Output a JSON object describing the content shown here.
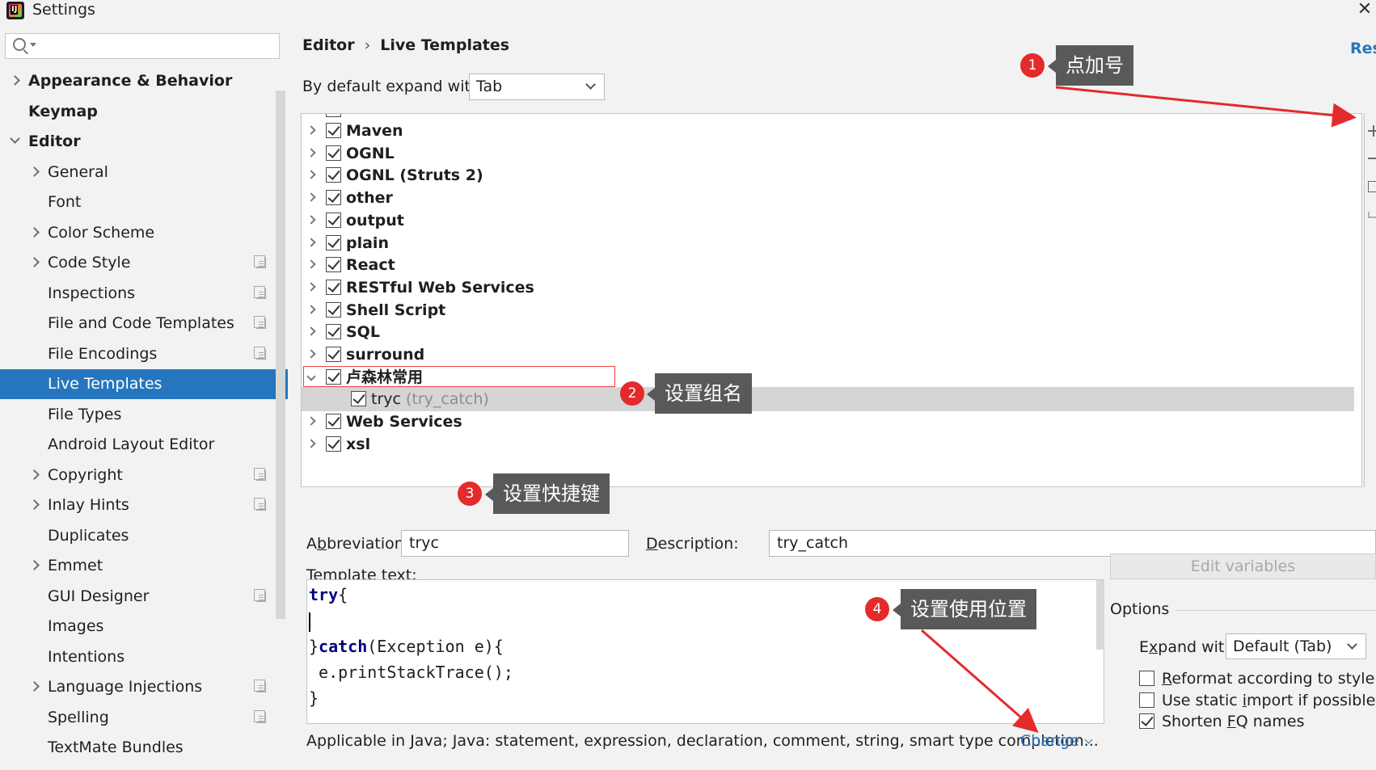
{
  "window": {
    "title": "Settings"
  },
  "sidebar": {
    "search": {
      "value": "",
      "placeholder": ""
    },
    "items": [
      {
        "label": "Appearance & Behavior",
        "level": "top",
        "arrow": "right"
      },
      {
        "label": "Keymap",
        "level": "top",
        "arrow": ""
      },
      {
        "label": "Editor",
        "level": "top",
        "arrow": "down"
      },
      {
        "label": "General",
        "level": "sub",
        "arrow": "right"
      },
      {
        "label": "Font",
        "level": "sub",
        "arrow": ""
      },
      {
        "label": "Color Scheme",
        "level": "sub",
        "arrow": "right"
      },
      {
        "label": "Code Style",
        "level": "sub",
        "arrow": "right",
        "project": true
      },
      {
        "label": "Inspections",
        "level": "sub",
        "arrow": "",
        "project": true
      },
      {
        "label": "File and Code Templates",
        "level": "sub",
        "arrow": "",
        "project": true
      },
      {
        "label": "File Encodings",
        "level": "sub",
        "arrow": "",
        "project": true
      },
      {
        "label": "Live Templates",
        "level": "sub",
        "arrow": "",
        "selected": true
      },
      {
        "label": "File Types",
        "level": "sub",
        "arrow": ""
      },
      {
        "label": "Android Layout Editor",
        "level": "sub",
        "arrow": ""
      },
      {
        "label": "Copyright",
        "level": "sub",
        "arrow": "right",
        "project": true
      },
      {
        "label": "Inlay Hints",
        "level": "sub",
        "arrow": "right",
        "project": true
      },
      {
        "label": "Duplicates",
        "level": "sub",
        "arrow": ""
      },
      {
        "label": "Emmet",
        "level": "sub",
        "arrow": "right"
      },
      {
        "label": "GUI Designer",
        "level": "sub",
        "arrow": "",
        "project": true
      },
      {
        "label": "Images",
        "level": "sub",
        "arrow": ""
      },
      {
        "label": "Intentions",
        "level": "sub",
        "arrow": ""
      },
      {
        "label": "Language Injections",
        "level": "sub",
        "arrow": "right",
        "project": true
      },
      {
        "label": "Spelling",
        "level": "sub",
        "arrow": "",
        "project": true
      },
      {
        "label": "TextMate Bundles",
        "level": "sub",
        "arrow": ""
      }
    ]
  },
  "main": {
    "breadcrumb": {
      "parent": "Editor",
      "separator": "›",
      "current": "Live Templates"
    },
    "reset_label": "Res",
    "expand": {
      "label": "By default expand with",
      "value": "Tab"
    },
    "templates": [
      {
        "label": "Maven",
        "checked": true,
        "type": "group",
        "expanded": false
      },
      {
        "label": "OGNL",
        "checked": true,
        "type": "group",
        "expanded": false
      },
      {
        "label": "OGNL (Struts 2)",
        "checked": true,
        "type": "group",
        "expanded": false
      },
      {
        "label": "other",
        "checked": true,
        "type": "group",
        "expanded": false
      },
      {
        "label": "output",
        "checked": true,
        "type": "group",
        "expanded": false
      },
      {
        "label": "plain",
        "checked": true,
        "type": "group",
        "expanded": false
      },
      {
        "label": "React",
        "checked": true,
        "type": "group",
        "expanded": false
      },
      {
        "label": "RESTful Web Services",
        "checked": true,
        "type": "group",
        "expanded": false
      },
      {
        "label": "Shell Script",
        "checked": true,
        "type": "group",
        "expanded": false
      },
      {
        "label": "SQL",
        "checked": true,
        "type": "group",
        "expanded": false
      },
      {
        "label": "surround",
        "checked": true,
        "type": "group",
        "expanded": false
      },
      {
        "label": "卢森林常用",
        "checked": true,
        "type": "group",
        "expanded": true,
        "outlined": true
      },
      {
        "label": "tryc",
        "desc": "(try_catch)",
        "checked": true,
        "type": "child"
      },
      {
        "label": "Web Services",
        "checked": true,
        "type": "group",
        "expanded": false
      },
      {
        "label": "xsl",
        "checked": true,
        "type": "group",
        "expanded": false
      }
    ],
    "abbreviation": {
      "label_pre": "A",
      "label_u": "b",
      "label_post": "breviation:",
      "value": "tryc"
    },
    "description": {
      "label_u": "D",
      "label_post": "escription:",
      "value": "try_catch"
    },
    "template_text": {
      "label_u": "T",
      "label_post": "emplate text:",
      "lines": [
        [
          {
            "t": "try",
            "c": "kw-b"
          },
          {
            "t": "{",
            "c": ""
          }
        ],
        [
          {
            "t": "",
            "c": "caret"
          }
        ],
        [
          {
            "t": "}",
            "c": ""
          },
          {
            "t": "catch",
            "c": "kw-b"
          },
          {
            "t": "(Exception e){",
            "c": ""
          }
        ],
        [
          {
            "t": " e.printStackTrace();",
            "c": ""
          }
        ],
        [
          {
            "t": "}",
            "c": ""
          }
        ]
      ]
    },
    "applicable": "Applicable in Java; Java: statement, expression, declaration, comment, string, smart type completion...",
    "change_label": "Change",
    "edit_variables_label": "Edit variables",
    "options": {
      "title": "Options",
      "expand_with": {
        "label_pre": "E",
        "label_u": "x",
        "label_post": "pand with",
        "value": "Default (Tab)"
      },
      "checkboxes": [
        {
          "pre": "",
          "u": "R",
          "post": "eformat according to style",
          "checked": false
        },
        {
          "pre": "Use static ",
          "u": "i",
          "post": "mport if possible",
          "checked": false
        },
        {
          "pre": "Shorten ",
          "u": "F",
          "post": "Q names",
          "checked": true
        }
      ]
    }
  },
  "annotations": [
    {
      "num": "1",
      "text": "点加号"
    },
    {
      "num": "2",
      "text": "设置组名"
    },
    {
      "num": "3",
      "text": "设置快捷键"
    },
    {
      "num": "4",
      "text": "设置使用位置"
    }
  ],
  "colors": {
    "accent": "#2675bf",
    "annotation_red": "#e32b2b",
    "callout_bg": "#595959"
  }
}
